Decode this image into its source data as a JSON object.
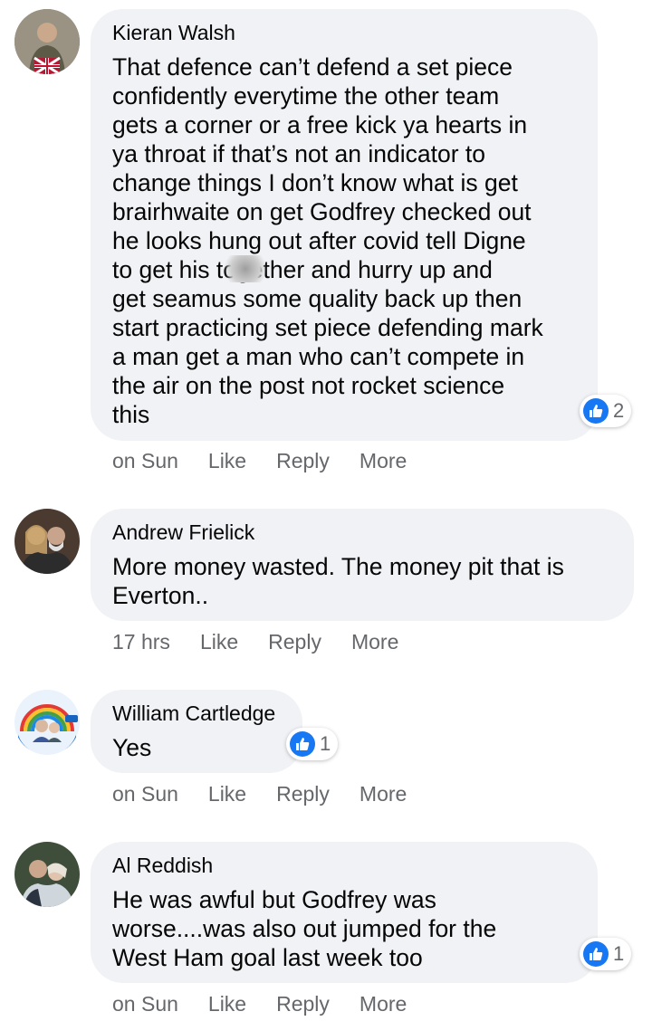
{
  "comments": [
    {
      "author": "Kieran Walsh",
      "text": "That defence can’t defend a set piece\nconfidently everytime the other team\ngets a corner or a free kick ya hearts in\nya throat if that’s not an indicator to\nchange things I don’t know what is get\nbrairhwaite on get Godfrey checked out\nhe looks hung out after covid tell Digne\nto get his      together and hurry up and\nget seamus some quality back up then\nstart practicing set piece defending mark\na man get a man who can’t compete in\nthe air on the post not rocket science\nthis",
      "reactions": "2",
      "time": "on Sun",
      "like": "Like",
      "reply": "Reply",
      "more": "More"
    },
    {
      "author": "Andrew Frielick",
      "text": "More money wasted. The money pit that is\nEverton..",
      "time": "17 hrs",
      "like": "Like",
      "reply": "Reply",
      "more": "More"
    },
    {
      "author": "William Cartledge",
      "text": "Yes",
      "reactions": "1",
      "time": "on Sun",
      "like": "Like",
      "reply": "Reply",
      "more": "More"
    },
    {
      "author": "Al Reddish",
      "text": "He was awful but Godfrey was\nworse....was also out jumped for the\nWest Ham goal last week too",
      "reactions": "1",
      "time": "on Sun",
      "like": "Like",
      "reply": "Reply",
      "more": "More"
    }
  ],
  "colors": {
    "bubble": "#f0f2f5",
    "like_blue": "#1877f2",
    "meta_gray": "#65676b"
  },
  "icons": {
    "reaction": "thumbs-up-icon"
  }
}
